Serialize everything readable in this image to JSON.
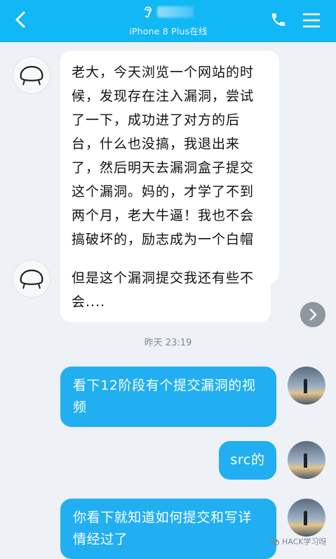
{
  "header": {
    "device_status": "iPhone 8 Plus在线",
    "back_icon": "chevron-left-icon",
    "call_icon": "phone-icon",
    "menu_icon": "hamburger-menu-icon",
    "accent_color": "#12b7f5"
  },
  "messages": [
    {
      "side": "left",
      "text": "老大，今天浏览一个网站的时候，发现存在注入漏洞，尝试了一下，成功进了对方的后台，什么也没搞，我退出来了，然后明天去漏洞盒子提交这个漏洞。妈的，才学了不到两个月，老大牛逼！我也不会搞破坏的，励志成为一个白帽子！"
    },
    {
      "side": "left",
      "text": "但是这个漏洞提交我还有些不会...."
    },
    {
      "side": "right",
      "text": "看下12阶段有个提交漏洞的视频"
    },
    {
      "side": "right",
      "text": "src的"
    },
    {
      "side": "right",
      "text": "你看下就知道如何提交和写详情经过了"
    }
  ],
  "timestamp": "昨天 23:19",
  "watermark": "HACK学习呀",
  "colors": {
    "bubble_right": "#21aff2",
    "bubble_left": "#ffffff",
    "background": "#eef1f5"
  }
}
